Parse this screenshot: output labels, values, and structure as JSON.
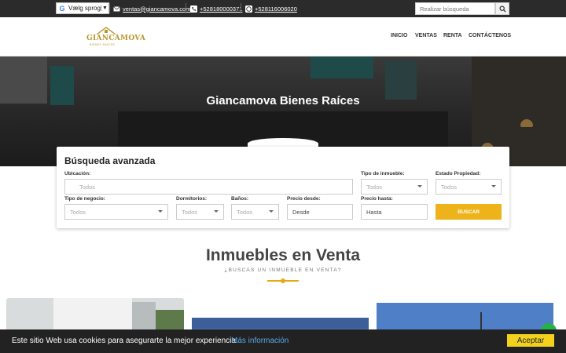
{
  "topbar": {
    "language_label": "Vælg sprog",
    "email": "ventas@giancamova.com",
    "phone": "+528180000371",
    "whatsapp": "+528116006020",
    "search_placeholder": "Realizar búsqueda"
  },
  "header": {
    "logo_text": "GIANCAMOVA",
    "logo_sub": "BIENES RAÍCES",
    "nav": [
      "INICIO",
      "VENTAS",
      "RENTA",
      "CONTÁCTENOS"
    ]
  },
  "hero": {
    "title": "Giancamova Bienes Raíces"
  },
  "search": {
    "title": "Búsqueda avanzada",
    "ubicacion_label": "Ubicación:",
    "ubicacion_placeholder": "Todos",
    "tipo_inmueble_label": "Tipo de inmueble:",
    "tipo_inmueble_value": "Todos",
    "estado_label": "Estado Propiedad:",
    "estado_value": "Todos",
    "negocio_label": "Tipo de negocio:",
    "negocio_value": "Todos",
    "dormitorios_label": "Dormitorios:",
    "dormitorios_value": "Todos",
    "banos_label": "Baños:",
    "banos_value": "Todos",
    "precio_desde_label": "Precio desde:",
    "precio_desde_placeholder": "Desde",
    "precio_hasta_label": "Precio hasta:",
    "precio_hasta_placeholder": "Hasta",
    "button": "BUSCAR"
  },
  "section": {
    "title": "Inmuebles en Venta",
    "subtitle": "¿BUSCAS UN INMUEBLE EN VENTA?"
  },
  "cookie": {
    "text": "Este sitio Web usa cookies para asegurarte la mejor experiencia.",
    "link": "Más información",
    "accept": "Aceptar"
  },
  "colors": {
    "accent": "#eeb31a",
    "topbar": "#2b2b2b",
    "cookie_bar": "#222222",
    "cookie_button": "#f2d21c"
  }
}
